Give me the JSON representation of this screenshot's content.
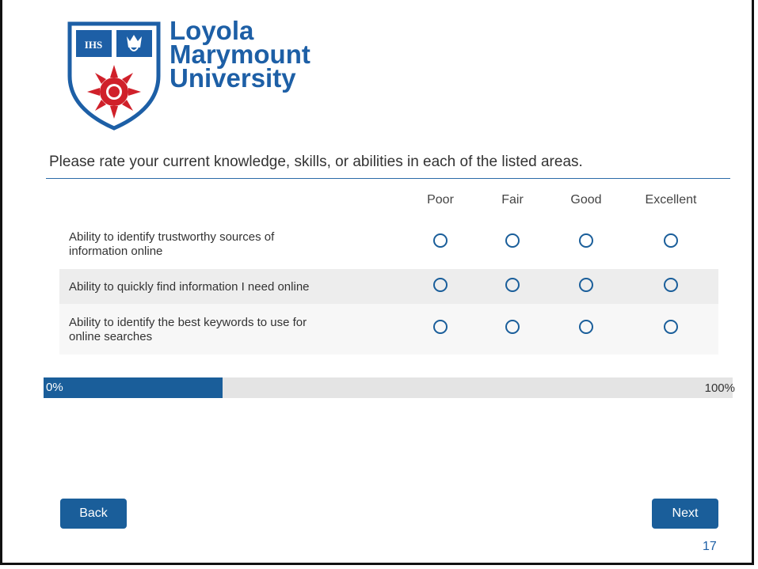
{
  "logo": {
    "line1": "Loyola",
    "line2": "Marymount",
    "line3": "University",
    "monogram": "IHS"
  },
  "question": "Please rate your current knowledge, skills, or abilities in each of the listed areas.",
  "scale": [
    "Poor",
    "Fair",
    "Good",
    "Excellent"
  ],
  "rows": [
    {
      "line1": "Ability to identify trustworthy sources of",
      "line2": "information online"
    },
    {
      "line1": "Ability to quickly find information I need online",
      "line2": ""
    },
    {
      "line1": "Ability to identify the best keywords to use for",
      "line2": "online searches"
    }
  ],
  "progress": {
    "fraction": 0.26,
    "start_label": "0%",
    "end_label": "100%"
  },
  "buttons": {
    "back": "Back",
    "next": "Next"
  },
  "page_number": "17",
  "colors": {
    "brand_blue": "#1d5fa6",
    "button_blue": "#1a5e9a",
    "logo_red": "#d0202a"
  }
}
